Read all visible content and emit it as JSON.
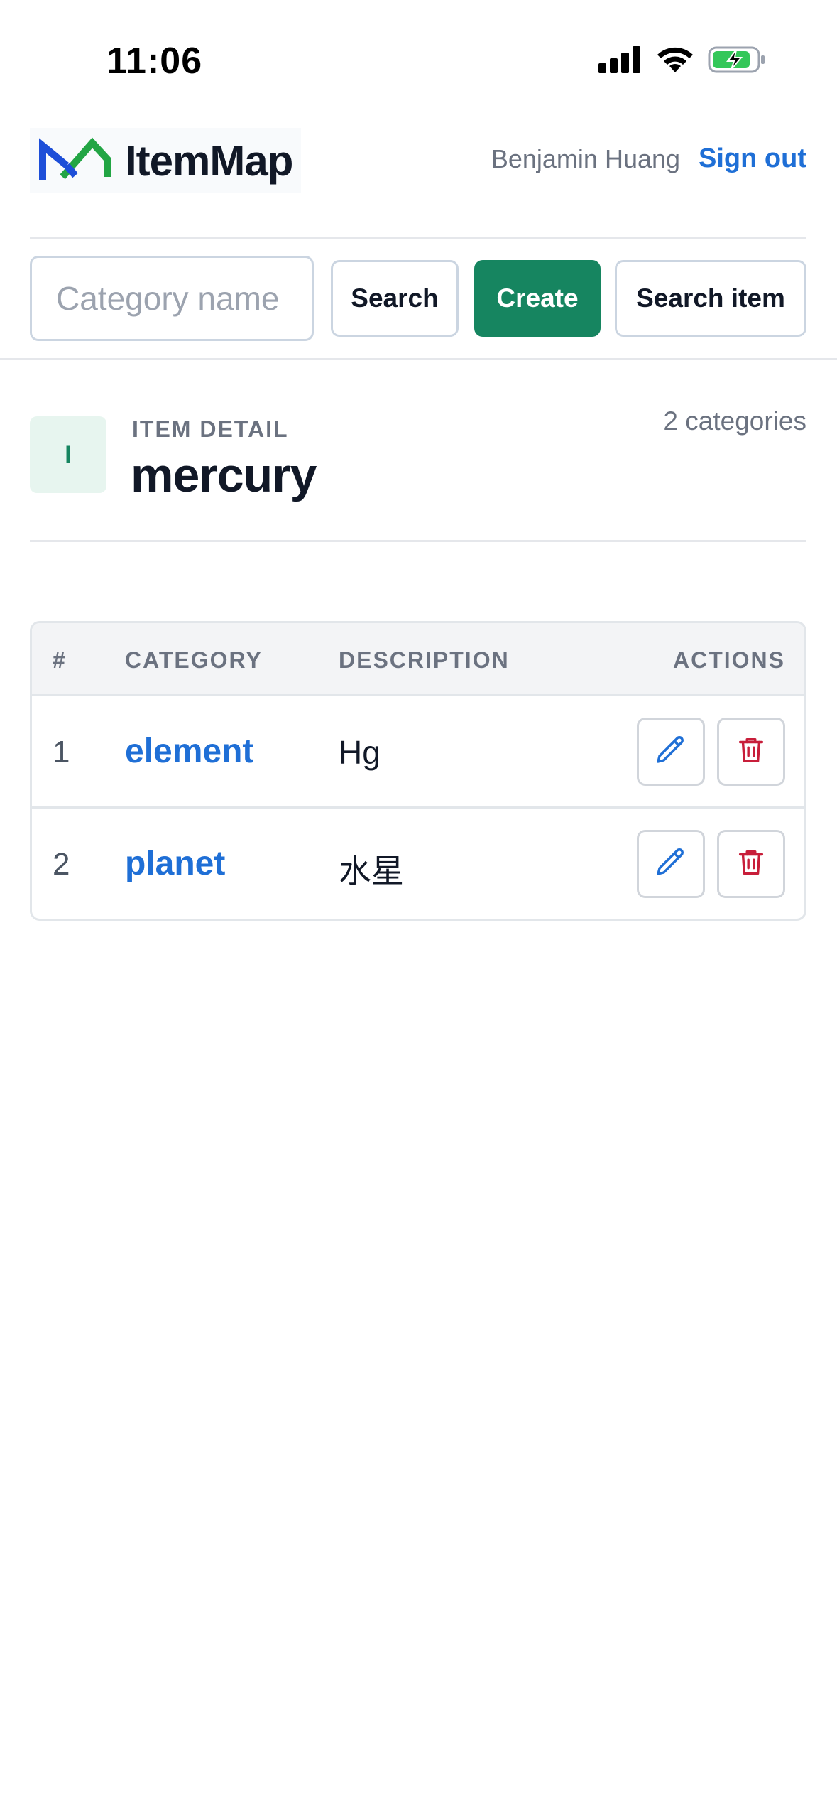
{
  "status_bar": {
    "time": "11:06"
  },
  "header": {
    "app_name": "ItemMap",
    "user_name": "Benjamin Huang",
    "sign_out_label": "Sign out"
  },
  "toolbar": {
    "category_placeholder": "Category name",
    "search_label": "Search",
    "create_label": "Create",
    "search_item_label": "Search item"
  },
  "item": {
    "badge_letter": "I",
    "eyebrow": "ITEM DETAIL",
    "name": "mercury",
    "category_count": "2 categories"
  },
  "table": {
    "columns": [
      "#",
      "CATEGORY",
      "DESCRIPTION",
      "ACTIONS"
    ],
    "rows": [
      {
        "num": "1",
        "category": "element",
        "description": "Hg"
      },
      {
        "num": "2",
        "category": "planet",
        "description": "水星"
      }
    ]
  },
  "colors": {
    "accent_blue": "#1f6fd6",
    "create_green": "#168560",
    "delete_red": "#c81e3a"
  }
}
